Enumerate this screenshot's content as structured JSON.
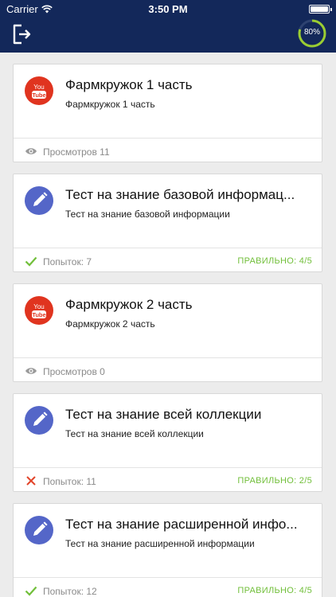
{
  "status_bar": {
    "carrier": "Carrier",
    "time": "3:50 PM"
  },
  "header": {
    "progress_label": "80%",
    "progress_value": 80
  },
  "colors": {
    "header_bg": "#13285a",
    "youtube_red": "#e0341f",
    "test_blue": "#5466c8",
    "success_green": "#71bf3a",
    "fail_red": "#e2442a",
    "progress_ring": "#9acd32"
  },
  "items": [
    {
      "type": "video",
      "icon": "youtube-icon",
      "title": "Фармкружок 1 часть",
      "subtitle": "Фармкружок 1 часть",
      "meta_icon": "eye-icon",
      "meta": "Просмотров 11",
      "score": ""
    },
    {
      "type": "test",
      "icon": "pencil-icon",
      "title": "Тест на знание базовой информац...",
      "subtitle": "Тест на знание базовой информации",
      "meta_icon": "check-icon",
      "meta": "Попыток: 7",
      "score": "ПРАВИЛЬНО: 4/5"
    },
    {
      "type": "video",
      "icon": "youtube-icon",
      "title": "Фармкружок 2 часть",
      "subtitle": "Фармкружок 2 часть",
      "meta_icon": "eye-icon",
      "meta": "Просмотров 0",
      "score": ""
    },
    {
      "type": "test",
      "icon": "pencil-icon",
      "title": "Тест на знание всей коллекции",
      "subtitle": "Тест на знание всей коллекции",
      "meta_icon": "cross-icon",
      "meta": "Попыток: 11",
      "score": "ПРАВИЛЬНО: 2/5"
    },
    {
      "type": "test",
      "icon": "pencil-icon",
      "title": "Тест на знание расширенной инфо...",
      "subtitle": "Тест на знание расширенной информации",
      "meta_icon": "check-icon",
      "meta": "Попыток: 12",
      "score": "ПРАВИЛЬНО: 4/5"
    }
  ]
}
